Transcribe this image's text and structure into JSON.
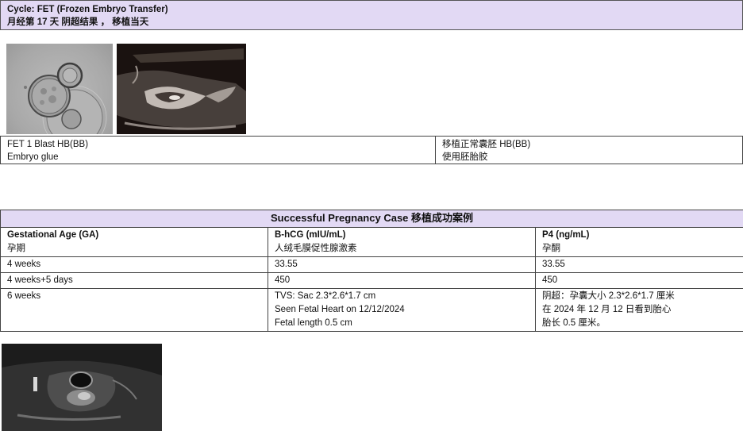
{
  "header": {
    "line1": "Cycle: FET (Frozen Embryo Transfer)",
    "line2": "月经第 17 天 阴超结果 ，  移植当天"
  },
  "fet_table": {
    "left": [
      "FET 1 Blast HB(BB)",
      "Embryo glue"
    ],
    "right": [
      "移植正常囊胚 HB(BB)",
      "使用胚胎胶"
    ]
  },
  "pregnancy_table": {
    "title": "Successful Pregnancy Case 移植成功案例",
    "headers": [
      {
        "en": "Gestational Age (GA)",
        "zh": "孕期"
      },
      {
        "en": "B-hCG (mIU/mL)",
        "zh": "人绒毛膜促性腺激素"
      },
      {
        "en": "P4 (ng/mL)",
        "zh": "孕酮"
      }
    ],
    "rows": [
      {
        "ga": "4 weeks",
        "bhcg": "33.55",
        "p4": "33.55"
      },
      {
        "ga": "4 weeks+5 days",
        "bhcg": "450",
        "p4": "450"
      }
    ],
    "last_row": {
      "ga": "6 weeks",
      "bhcg": [
        "TVS: Sac 2.3*2.6*1.7 cm",
        "Seen Fetal Heart on 12/12/2024",
        "Fetal length 0.5 cm"
      ],
      "p4": [
        "阴超：孕囊大小 2.3*2.6*1.7 厘米",
        "在 2024 年 12 月 12 日看到胎心",
        "胎长 0.5 厘米。"
      ]
    }
  },
  "colors": {
    "header_bg": "#e2d9f4",
    "border": "#444444"
  }
}
